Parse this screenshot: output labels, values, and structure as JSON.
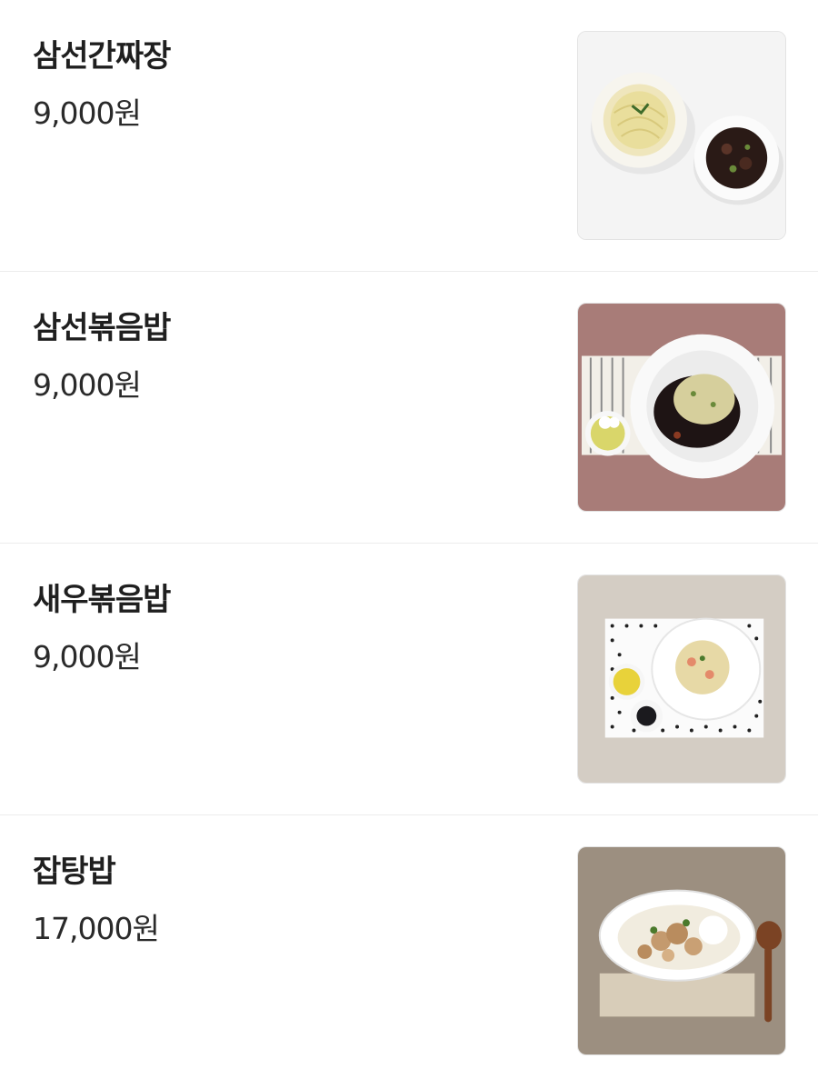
{
  "menu": {
    "items": [
      {
        "name": "삼선간짜장",
        "price": "9,000원",
        "image": "noodles-with-black-bean-sauce-photo"
      },
      {
        "name": "삼선볶음밥",
        "price": "9,000원",
        "image": "fried-rice-with-black-bean-sauce-photo"
      },
      {
        "name": "새우볶음밥",
        "price": "9,000원",
        "image": "shrimp-fried-rice-photo"
      },
      {
        "name": "잡탕밥",
        "price": "17,000원",
        "image": "seafood-stir-fry-rice-photo"
      }
    ]
  }
}
